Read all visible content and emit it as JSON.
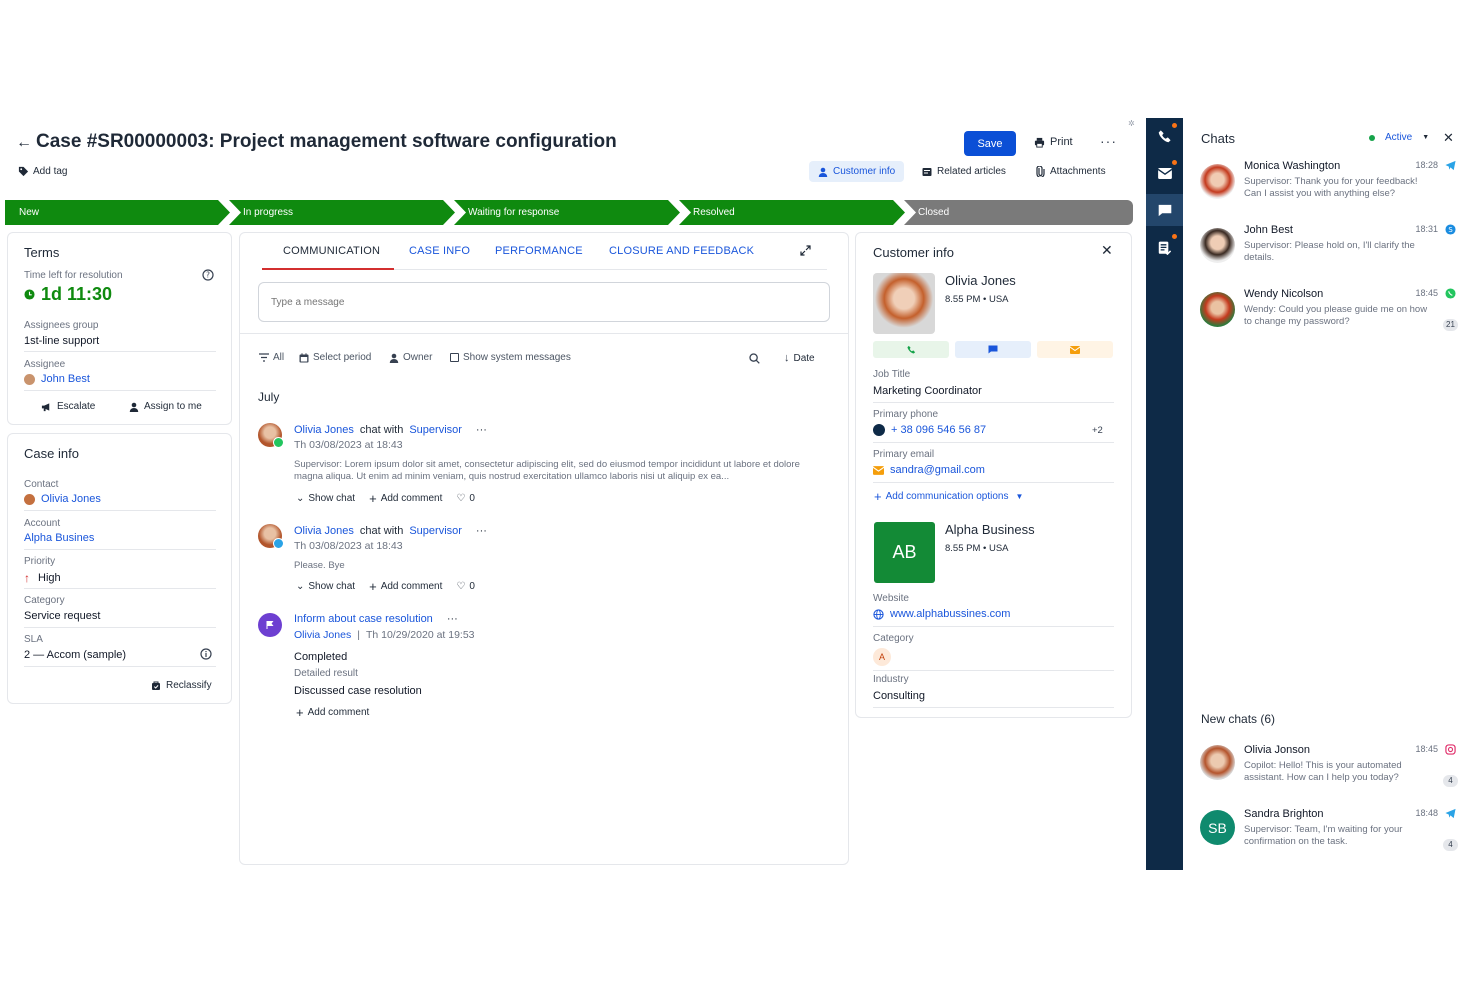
{
  "header": {
    "title": "Case #SR00000003: Project management software configuration",
    "add_tag": "Add tag",
    "save": "Save",
    "print": "Print",
    "more": "···",
    "tabs": [
      "Customer info",
      "Related articles",
      "Attachments"
    ]
  },
  "stages": [
    "New",
    "In progress",
    "Waiting for response",
    "Resolved",
    "Closed"
  ],
  "terms": {
    "title": "Terms",
    "time_left_label": "Time left for resolution",
    "time_left": "1d 11:30",
    "assignees_group_label": "Assignees group",
    "assignees_group": "1st-line support",
    "assignee_label": "Assignee",
    "assignee": "John Best",
    "escalate": "Escalate",
    "assign_to_me": "Assign to me"
  },
  "case_info": {
    "title": "Case info",
    "contact_label": "Contact",
    "contact": "Olivia Jones",
    "account_label": "Account",
    "account": "Alpha Busines",
    "priority_label": "Priority",
    "priority": "High",
    "category_label": "Category",
    "category": "Service request",
    "sla_label": "SLA",
    "sla": "2 — Accom (sample)",
    "reclassify": "Reclassify"
  },
  "middle": {
    "tabs": [
      "COMMUNICATION",
      "CASE INFO",
      "PERFORMANCE",
      "CLOSURE AND FEEDBACK"
    ],
    "message_placeholder": "Type a message",
    "filters": {
      "all": "All",
      "select_period": "Select period",
      "owner": "Owner",
      "show_system": "Show system messages",
      "date": "Date"
    },
    "month": "July",
    "feed": [
      {
        "name": "Olivia Jones",
        "mid": "chat with",
        "target": "Supervisor",
        "more": "···",
        "time": "Th 03/08/2023 at 18:43",
        "text": "Supervisor: Lorem ipsum dolor sit amet, consectetur adipiscing elit, sed do eiusmod tempor incididunt ut labore et dolore magna aliqua. Ut enim ad minim veniam, quis nostrud exercitation ullamco laboris nisi ut aliquip ex ea...",
        "show_chat": "Show chat",
        "add_comment": "Add comment",
        "likes": "0"
      },
      {
        "name": "Olivia Jones",
        "mid": "chat with",
        "target": "Supervisor",
        "more": "···",
        "time": "Th 03/08/2023 at 18:43",
        "text": "Please. Bye",
        "show_chat": "Show chat",
        "add_comment": "Add comment",
        "likes": "0"
      }
    ],
    "task": {
      "title": "Inform about case resolution",
      "more": "···",
      "owner": "Olivia Jones",
      "time": "Th 10/29/2020 at 19:53",
      "status": "Completed",
      "result_label": "Detailed result",
      "result": "Discussed case resolution",
      "add_comment": "Add comment"
    }
  },
  "customer": {
    "title": "Customer info",
    "name": "Olivia Jones",
    "local": "8.55 PM • USA",
    "job_label": "Job Title",
    "job": "Marketing Coordinator",
    "phone_label": "Primary phone",
    "phone": "+ 38 096 546 56 87",
    "phone_more": "+2",
    "email_label": "Primary email",
    "email": "sandra@gmail.com",
    "add_options": "Add communication options",
    "account_initials": "AB",
    "account_name": "Alpha Business",
    "account_local": "8.55 PM • USA",
    "website_label": "Website",
    "website": "www.alphabussines.com",
    "category_label": "Category",
    "category": "A",
    "industry_label": "Industry",
    "industry": "Consulting"
  },
  "chats": {
    "title": "Chats",
    "status": "Active",
    "items": [
      {
        "name": "Monica Washington",
        "time": "18:28",
        "msg": "Supervisor: Thank you for your feedback! Can I assist you with anything else?",
        "channel": "telegram"
      },
      {
        "name": "John Best",
        "time": "18:31",
        "msg": "Supervisor: Please hold on, I'll clarify the details.",
        "channel": "skype"
      },
      {
        "name": "Wendy Nicolson",
        "time": "18:45",
        "msg": "Wendy: Could you please guide me on how to change my password?",
        "channel": "whatsapp",
        "count": "21"
      }
    ],
    "new_title": "New chats (6)",
    "new_items": [
      {
        "name": "Olivia Jonson",
        "time": "18:45",
        "msg": "Copilot: Hello! This is your automated assistant. How can I help you today?",
        "channel": "instagram",
        "count": "4"
      },
      {
        "name": "Sandra Brighton",
        "initials": "SB",
        "time": "18:48",
        "msg": "Supervisor: Team, I'm waiting for your confirmation on the task.",
        "channel": "telegram",
        "count": "4"
      }
    ]
  },
  "colors": {
    "accent": "#1a56db",
    "stage_green": "#0f8a0f",
    "stage_grey": "#7a7a7a",
    "rail": "#0e2a47",
    "danger": "#d32f2f"
  }
}
